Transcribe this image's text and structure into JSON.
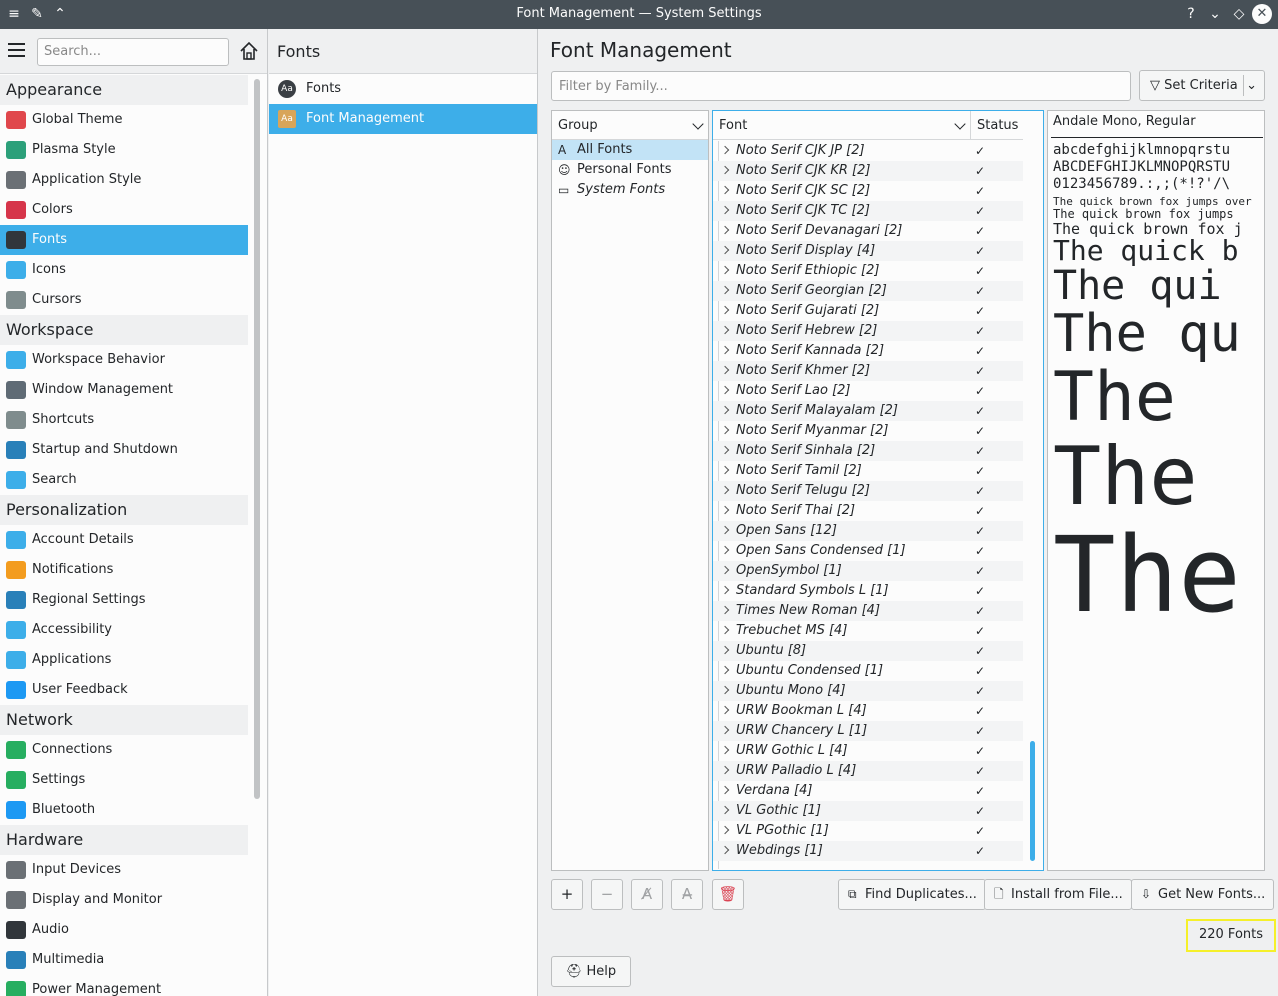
{
  "window": {
    "title": "Font Management — System Settings"
  },
  "sidebar": {
    "search_placeholder": "Search...",
    "categories": [
      {
        "label": "Appearance",
        "items": [
          {
            "label": "Global Theme",
            "icon": "global-theme-icon",
            "color": "#e0474c"
          },
          {
            "label": "Plasma Style",
            "icon": "plasma-style-icon",
            "color": "#2ca07a"
          },
          {
            "label": "Application Style",
            "icon": "application-style-icon",
            "color": "#6b7075"
          },
          {
            "label": "Colors",
            "icon": "colors-icon",
            "color": "#d6354a"
          },
          {
            "label": "Fonts",
            "icon": "fonts-icon",
            "color": "#31363b",
            "selected": true
          },
          {
            "label": "Icons",
            "icon": "icons-icon",
            "color": "#3daee9"
          },
          {
            "label": "Cursors",
            "icon": "cursors-icon",
            "color": "#7f8c8d"
          }
        ]
      },
      {
        "label": "Workspace",
        "items": [
          {
            "label": "Workspace Behavior",
            "icon": "workspace-behavior-icon",
            "color": "#3daee9"
          },
          {
            "label": "Window Management",
            "icon": "window-management-icon",
            "color": "#5f6b75"
          },
          {
            "label": "Shortcuts",
            "icon": "shortcuts-icon",
            "color": "#7f8c8d"
          },
          {
            "label": "Startup and Shutdown",
            "icon": "startup-shutdown-icon",
            "color": "#2980b9"
          },
          {
            "label": "Search",
            "icon": "search-icon",
            "color": "#3daee9"
          }
        ]
      },
      {
        "label": "Personalization",
        "items": [
          {
            "label": "Account Details",
            "icon": "account-details-icon",
            "color": "#3daee9"
          },
          {
            "label": "Notifications",
            "icon": "notifications-icon",
            "color": "#f39c1f"
          },
          {
            "label": "Regional Settings",
            "icon": "regional-settings-icon",
            "color": "#2980b9"
          },
          {
            "label": "Accessibility",
            "icon": "accessibility-icon",
            "color": "#3daee9"
          },
          {
            "label": "Applications",
            "icon": "applications-icon",
            "color": "#3daee9"
          },
          {
            "label": "User Feedback",
            "icon": "user-feedback-icon",
            "color": "#1d99f3"
          }
        ]
      },
      {
        "label": "Network",
        "items": [
          {
            "label": "Connections",
            "icon": "connections-icon",
            "color": "#27ae60"
          },
          {
            "label": "Settings",
            "icon": "network-settings-icon",
            "color": "#27ae60"
          },
          {
            "label": "Bluetooth",
            "icon": "bluetooth-icon",
            "color": "#1d99f3"
          }
        ]
      },
      {
        "label": "Hardware",
        "items": [
          {
            "label": "Input Devices",
            "icon": "input-devices-icon",
            "color": "#6b7075"
          },
          {
            "label": "Display and Monitor",
            "icon": "display-monitor-icon",
            "color": "#6b7075"
          },
          {
            "label": "Audio",
            "icon": "audio-icon",
            "color": "#31363b"
          },
          {
            "label": "Multimedia",
            "icon": "multimedia-icon",
            "color": "#2980b9"
          },
          {
            "label": "Power Management",
            "icon": "power-management-icon",
            "color": "#27ae60"
          }
        ]
      }
    ]
  },
  "midpanel": {
    "title": "Fonts",
    "items": [
      {
        "label": "Fonts",
        "icon": "fonts-icon"
      },
      {
        "label": "Font Management",
        "icon": "font-management-icon",
        "selected": true
      }
    ]
  },
  "main": {
    "title": "Font Management",
    "filter_placeholder": "Filter by Family...",
    "set_criteria": "Set Criteria",
    "group_header": "Group",
    "groups": [
      {
        "label": "All Fonts",
        "icon": "A",
        "selected": true
      },
      {
        "label": "Personal Fonts",
        "icon": "☺"
      },
      {
        "label": "System Fonts",
        "icon": "▭"
      }
    ],
    "font_header": "Font",
    "status_header": "Status",
    "fonts": [
      "Noto Serif CJK JP [2]",
      "Noto Serif CJK KR [2]",
      "Noto Serif CJK SC [2]",
      "Noto Serif CJK TC [2]",
      "Noto Serif Devanagari [2]",
      "Noto Serif Display [4]",
      "Noto Serif Ethiopic [2]",
      "Noto Serif Georgian [2]",
      "Noto Serif Gujarati [2]",
      "Noto Serif Hebrew [2]",
      "Noto Serif Kannada [2]",
      "Noto Serif Khmer [2]",
      "Noto Serif Lao [2]",
      "Noto Serif Malayalam [2]",
      "Noto Serif Myanmar [2]",
      "Noto Serif Sinhala [2]",
      "Noto Serif Tamil [2]",
      "Noto Serif Telugu [2]",
      "Noto Serif Thai [2]",
      "Open Sans [12]",
      "Open Sans Condensed [1]",
      "OpenSymbol [1]",
      "Standard Symbols L [1]",
      "Times New Roman [4]",
      "Trebuchet MS [4]",
      "Ubuntu [8]",
      "Ubuntu Condensed [1]",
      "Ubuntu Mono [4]",
      "URW Bookman L [4]",
      "URW Chancery L [1]",
      "URW Gothic L [4]",
      "URW Palladio L [4]",
      "Verdana [4]",
      "VL Gothic [1]",
      "VL PGothic [1]",
      "Webdings [1]"
    ],
    "preview": {
      "font_name": "Andale Mono, Regular",
      "lower": "abcdefghijklmnopqrstu",
      "upper": "ABCDEFGHIJKLMNOPQRSTU",
      "digits": "0123456789.:,;(*!?'/\\",
      "samples": [
        "The quick brown fox jumps over",
        "The quick brown fox jumps",
        "The quick brown fox j",
        "The quick b",
        "The qui",
        "The qu",
        "The",
        "The",
        "The"
      ]
    },
    "buttons": {
      "find_duplicates": "Find Duplicates...",
      "install_from_file": "Install from File...",
      "get_new_fonts": "Get New Fonts...",
      "help": "Help"
    },
    "font_count": "220 Fonts"
  }
}
